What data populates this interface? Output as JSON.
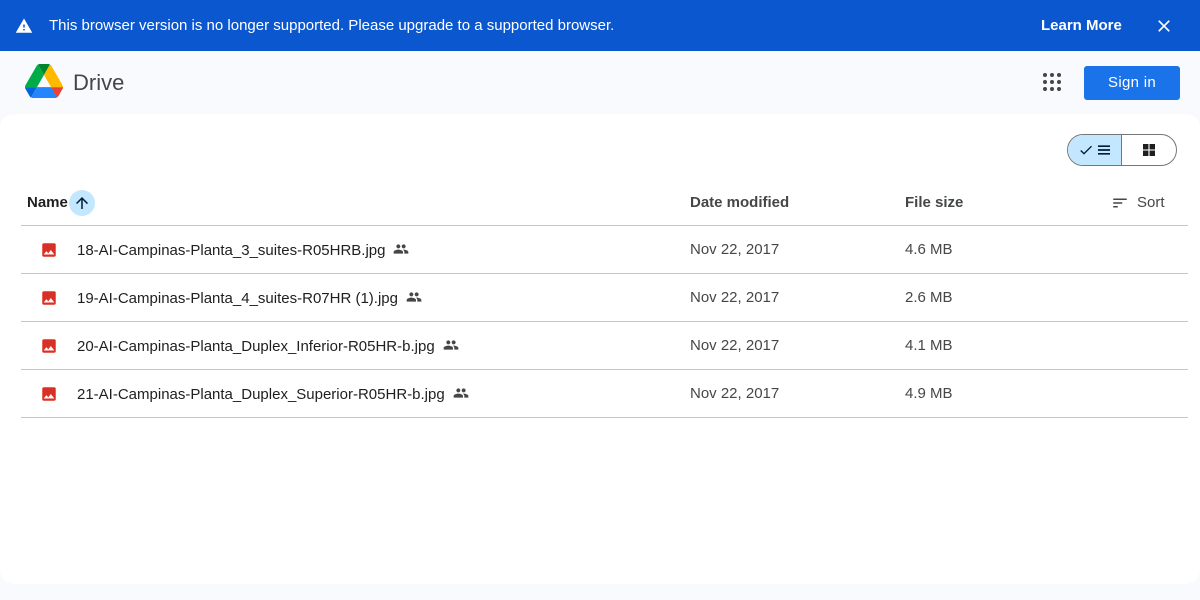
{
  "banner": {
    "message": "This browser version is no longer supported. Please upgrade to a supported browser.",
    "learn_more": "Learn More",
    "warning_icon": "warning-icon",
    "close_icon": "close-icon",
    "background": "#0b57d0"
  },
  "header": {
    "brand": "Drive",
    "apps_icon": "apps-grid-icon",
    "sign_in": "Sign in",
    "accent": "#1a73e8"
  },
  "view_toggle": {
    "active": "list",
    "list_icon": "check-list-icon",
    "grid_icon": "grid-view-icon"
  },
  "table": {
    "columns": {
      "name": "Name",
      "date": "Date modified",
      "size": "File size",
      "sort": "Sort"
    },
    "sort_direction_icon": "arrow-up-icon",
    "rows": [
      {
        "name": "18-AI-Campinas-Planta_3_suites-R05HRB.jpg",
        "date": "Nov 22, 2017",
        "size": "4.6 MB",
        "icon": "image-file-icon",
        "shared": true
      },
      {
        "name": "19-AI-Campinas-Planta_4_suites-R07HR (1).jpg",
        "date": "Nov 22, 2017",
        "size": "2.6 MB",
        "icon": "image-file-icon",
        "shared": true
      },
      {
        "name": "20-AI-Campinas-Planta_Duplex_Inferior-R05HR-b.jpg",
        "date": "Nov 22, 2017",
        "size": "4.1 MB",
        "icon": "image-file-icon",
        "shared": true
      },
      {
        "name": "21-AI-Campinas-Planta_Duplex_Superior-R05HR-b.jpg",
        "date": "Nov 22, 2017",
        "size": "4.9 MB",
        "icon": "image-file-icon",
        "shared": true
      }
    ],
    "file_icon_color": "#d93025"
  }
}
